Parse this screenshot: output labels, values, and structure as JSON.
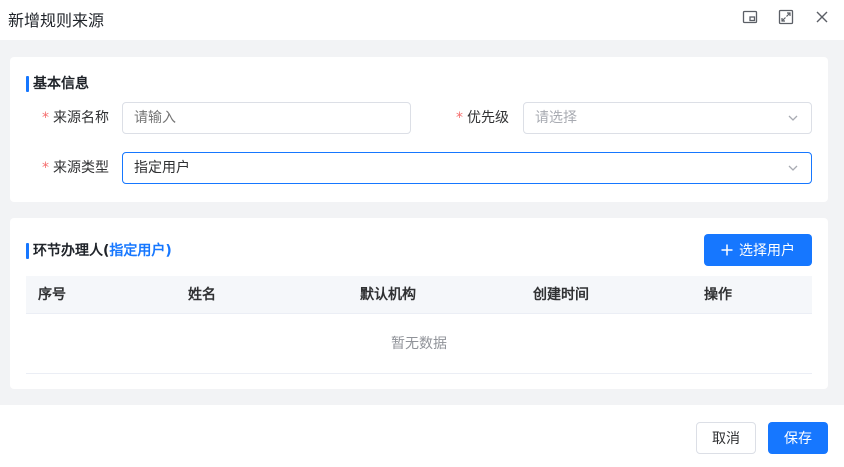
{
  "dialog": {
    "title": "新增规则来源",
    "window_controls": [
      "minimize-window-icon",
      "maximize-window-icon",
      "close-icon"
    ]
  },
  "basic_info": {
    "section_title": "基本信息",
    "required_mark": "*",
    "source_name": {
      "label": "来源名称",
      "placeholder": "请输入",
      "value": ""
    },
    "priority": {
      "label": "优先级",
      "placeholder": "请选择",
      "value": ""
    },
    "source_type": {
      "label": "来源类型",
      "value": "指定用户"
    }
  },
  "handler": {
    "section_title_prefix": "环节办理人(",
    "section_title_accent": "指定用户",
    "section_title_suffix": ")",
    "select_user_button": "选择用户",
    "columns": [
      "序号",
      "姓名",
      "默认机构",
      "创建时间",
      "操作"
    ],
    "empty_text": "暂无数据"
  },
  "footer": {
    "cancel_label": "取消",
    "save_label": "保存"
  },
  "colors": {
    "primary": "#1677ff",
    "required": "#f56c6c",
    "background": "#f2f3f5"
  }
}
